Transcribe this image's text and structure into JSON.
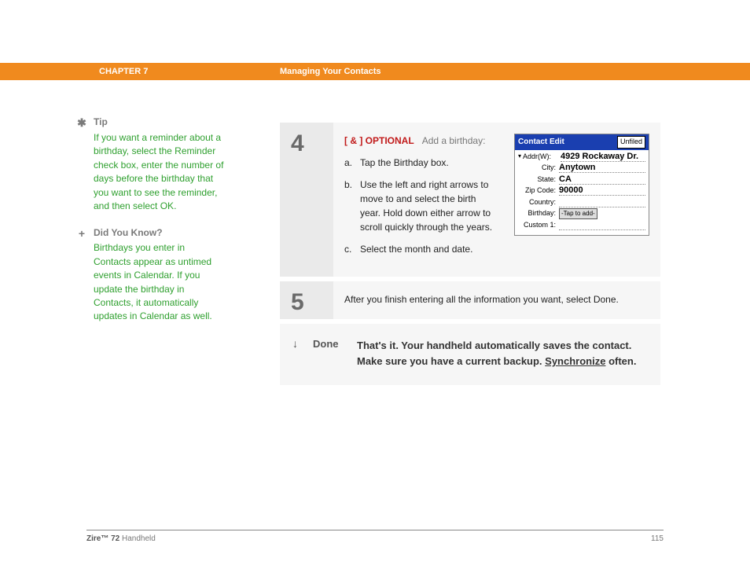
{
  "header": {
    "chapter": "CHAPTER 7",
    "section": "Managing Your Contacts"
  },
  "sidebar": {
    "tip": {
      "title": "Tip",
      "body": "If you want a reminder about a birthday, select the Reminder check box, enter the number of days before the birthday that you want to see the reminder, and then select OK."
    },
    "dyk": {
      "title": "Did You Know?",
      "body": "Birthdays you enter in Contacts appear as untimed events in Calendar. If you update the birthday in Contacts, it automatically updates in Calendar as well."
    }
  },
  "steps": {
    "s4": {
      "num": "4",
      "optional_prefix": "[ & ]  OPTIONAL",
      "optional_text": "Add a birthday:",
      "a_letter": "a.",
      "a": "Tap the Birthday box.",
      "b_letter": "b.",
      "b": "Use the left and right arrows to move to and select the birth year. Hold down either arrow to scroll quickly through the years.",
      "c_letter": "c.",
      "c": "Select the month and date."
    },
    "s5": {
      "num": "5",
      "text": "After you finish entering all the information you want, select Done."
    }
  },
  "screenshot": {
    "title": "Contact Edit",
    "category": "Unfiled",
    "addr_label": "Addr(W):",
    "addr_value": "4929 Rockaway Dr.",
    "city_label": "City:",
    "city_value": "Anytown",
    "state_label": "State:",
    "state_value": "CA",
    "zip_label": "Zip Code:",
    "zip_value": "90000",
    "country_label": "Country:",
    "birthday_label": "Birthday:",
    "tap_to_add": "-Tap to add-",
    "custom_label": "Custom 1:"
  },
  "done": {
    "label": "Done",
    "text_before": "That's it. Your handheld automatically saves the contact. Make sure you have a current backup. ",
    "sync": "Synchronize",
    "text_after": " often."
  },
  "footer": {
    "product_bold": "Zire™ 72",
    "product_rest": " Handheld",
    "page": "115"
  }
}
